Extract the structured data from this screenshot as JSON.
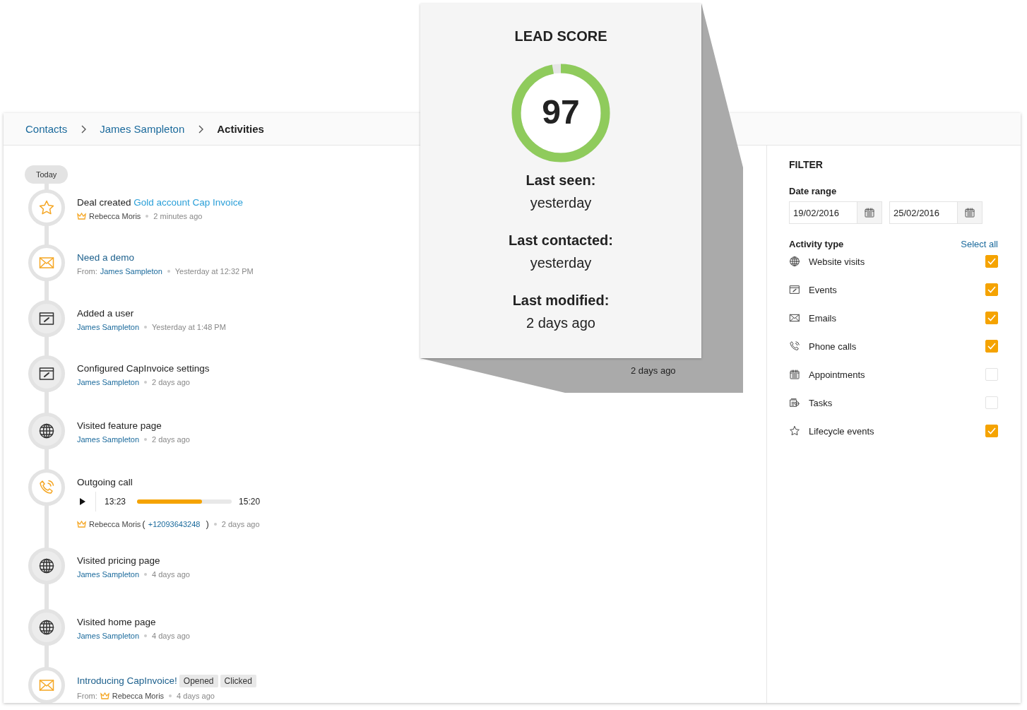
{
  "breadcrumb": [
    {
      "label": "Contacts",
      "kind": "link"
    },
    {
      "label": "James Sampleton",
      "kind": "link"
    },
    {
      "label": "Activities",
      "kind": "current"
    }
  ],
  "timeline_marker": "Today",
  "activities": [
    {
      "kind": "deal",
      "title": "Deal created",
      "title_link": "Gold account Cap Invoice",
      "person": "Rebecca Moris",
      "agent": true,
      "time": "2 minutes ago"
    },
    {
      "kind": "email",
      "title_link": "Need a demo",
      "from_label": "From:",
      "person": "James Sampleton",
      "agent": false,
      "time": "Yesterday at 12:32 PM"
    },
    {
      "kind": "app",
      "title": "Added a user",
      "person": "James Sampleton",
      "agent": false,
      "time": "Yesterday at 1:48 PM"
    },
    {
      "kind": "app",
      "title": "Configured CapInvoice settings",
      "person": "James Sampleton",
      "agent": false,
      "time": "2 days ago"
    },
    {
      "kind": "web",
      "title": "Visited feature page",
      "person": "James Sampleton",
      "agent": false,
      "time": "2 days ago"
    },
    {
      "kind": "call",
      "title": "Outgoing call",
      "player": {
        "current": "13:23",
        "total": "15:20",
        "level": 0.69
      },
      "person": "Rebecca Moris",
      "agent": true,
      "phone": {
        "open": "(",
        "number": "+12093643248",
        "close": ")"
      },
      "time": "2 days ago"
    },
    {
      "kind": "web",
      "title": "Visited pricing page",
      "person": "James Sampleton",
      "agent": false,
      "time": "4 days ago"
    },
    {
      "kind": "web",
      "title": "Visited home page",
      "person": "James Sampleton",
      "agent": false,
      "time": "4 days ago"
    },
    {
      "kind": "email",
      "title_link": "Introducing CapInvoice!",
      "tags": [
        "Opened",
        "Clicked"
      ],
      "from_label": "From:",
      "person": "Rebecca Moris",
      "agent": true,
      "time": "4 days ago"
    }
  ],
  "lead_score": {
    "title": "LEAD SCORE",
    "score": "97",
    "level": 0.97,
    "facts": [
      {
        "label": "Last seen:",
        "value": "yesterday"
      },
      {
        "label": "Last contacted:",
        "value": "yesterday"
      },
      {
        "label": "Last modified:",
        "value": "2 days ago"
      }
    ],
    "shadow_value": "2 days ago"
  },
  "filter": {
    "title": "FILTER",
    "date_label": "Date range",
    "date_from": "19/02/2016",
    "date_to": "25/02/2016",
    "type_label": "Activity type",
    "select_all": "Select all",
    "types": [
      {
        "kind": "web",
        "label": "Website visits",
        "checked": true
      },
      {
        "kind": "event",
        "label": "Events",
        "checked": true
      },
      {
        "kind": "email",
        "label": "Emails",
        "checked": true
      },
      {
        "kind": "call",
        "label": "Phone calls",
        "checked": true
      },
      {
        "kind": "appointment",
        "label": "Appointments",
        "checked": false
      },
      {
        "kind": "task",
        "label": "Tasks",
        "checked": false
      },
      {
        "kind": "lifecycle",
        "label": "Lifecycle events",
        "checked": true
      }
    ]
  }
}
